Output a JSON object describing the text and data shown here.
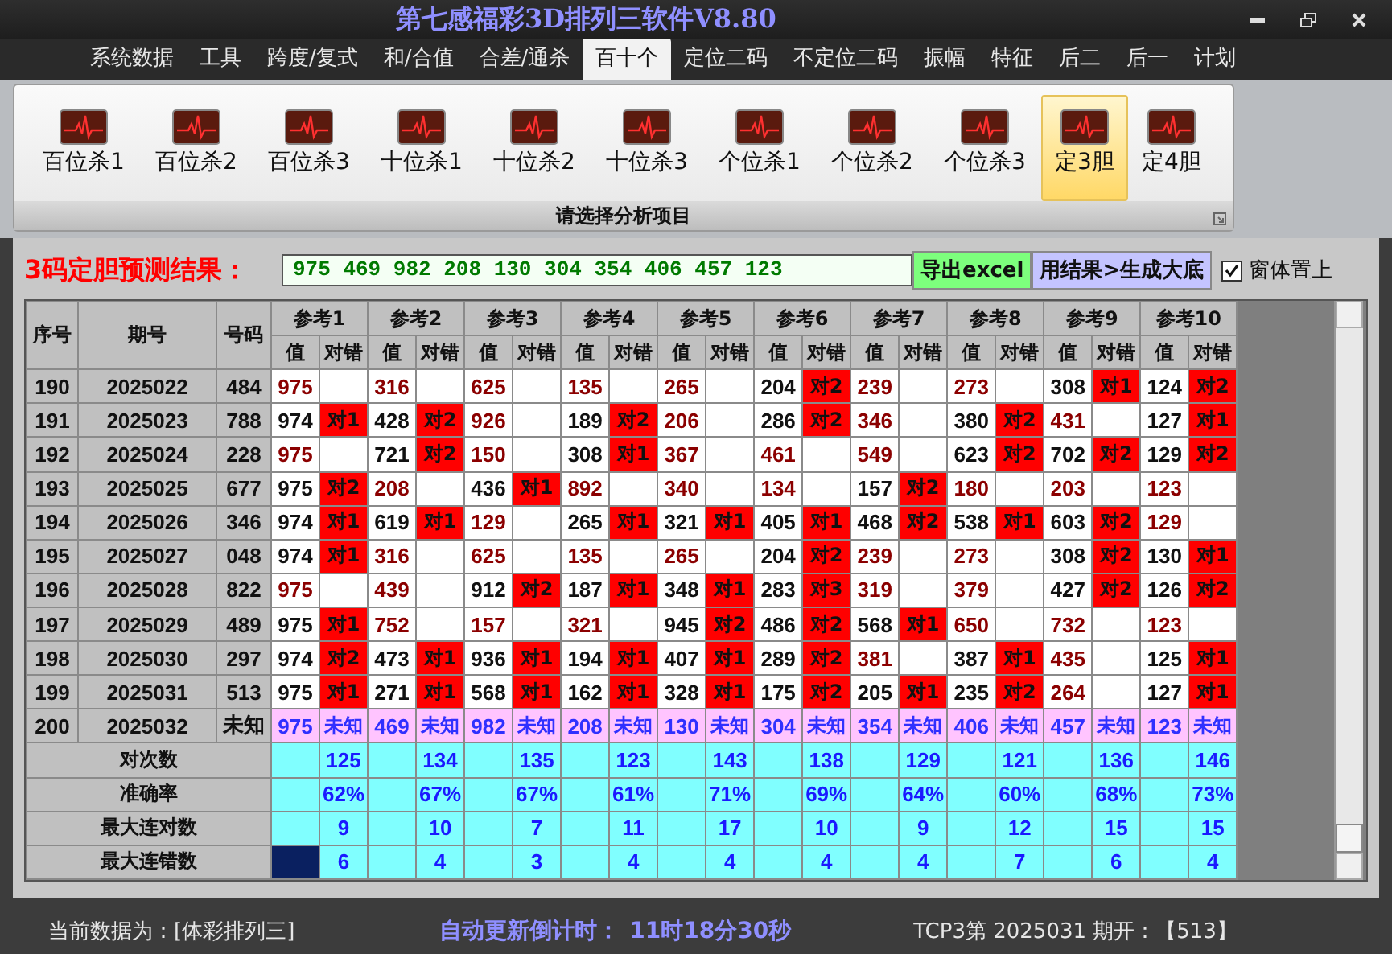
{
  "window": {
    "title": "第七感福彩3D排列三软件V8.80"
  },
  "menu": [
    {
      "label": "系统数据",
      "selected": false
    },
    {
      "label": "工具",
      "selected": false
    },
    {
      "label": "跨度/复式",
      "selected": false
    },
    {
      "label": "和/合值",
      "selected": false
    },
    {
      "label": "合差/通杀",
      "selected": false
    },
    {
      "label": "百十个",
      "selected": true
    },
    {
      "label": "定位二码",
      "selected": false
    },
    {
      "label": "不定位二码",
      "selected": false
    },
    {
      "label": "振幅",
      "selected": false
    },
    {
      "label": "特征",
      "selected": false
    },
    {
      "label": "后二",
      "selected": false
    },
    {
      "label": "后一",
      "selected": false
    },
    {
      "label": "计划",
      "selected": false
    }
  ],
  "ribbon": {
    "items": [
      {
        "label": "百位杀1",
        "selected": false
      },
      {
        "label": "百位杀2",
        "selected": false
      },
      {
        "label": "百位杀3",
        "selected": false
      },
      {
        "label": "十位杀1",
        "selected": false
      },
      {
        "label": "十位杀2",
        "selected": false
      },
      {
        "label": "十位杀3",
        "selected": false
      },
      {
        "label": "个位杀1",
        "selected": false
      },
      {
        "label": "个位杀2",
        "selected": false
      },
      {
        "label": "个位杀3",
        "selected": false
      },
      {
        "label": "定3胆",
        "selected": true
      },
      {
        "label": "定4胆",
        "selected": false
      }
    ],
    "group_label": "请选择分析项目"
  },
  "prediction": {
    "label": "3码定胆预测结果：",
    "value": "975 469 982 208 130 304 354 406 457 123",
    "export_button": "导出excel",
    "generate_button": "用结果>生成大底",
    "topmost_checkbox": {
      "label": "窗体置上",
      "checked": true
    }
  },
  "table": {
    "seq_header": "序号",
    "issue_header": "期号",
    "number_header": "号码",
    "refs": [
      {
        "label": "参考1",
        "value_header": "值",
        "result_header": "对错"
      },
      {
        "label": "参考2",
        "value_header": "值",
        "result_header": "对错"
      },
      {
        "label": "参考3",
        "value_header": "值",
        "result_header": "对错"
      },
      {
        "label": "参考4",
        "value_header": "值",
        "result_header": "对错"
      },
      {
        "label": "参考5",
        "value_header": "值",
        "result_header": "对错"
      },
      {
        "label": "参考6",
        "value_header": "值",
        "result_header": "对错"
      },
      {
        "label": "参考7",
        "value_header": "值",
        "result_header": "对错"
      },
      {
        "label": "参考8",
        "value_header": "值",
        "result_header": "对错"
      },
      {
        "label": "参考9",
        "value_header": "值",
        "result_header": "对错"
      },
      {
        "label": "参考10",
        "value_header": "值",
        "result_header": "对错"
      }
    ],
    "rows": [
      {
        "kind": "history",
        "seq": "190",
        "issue": "2025022",
        "number": "484",
        "cells": [
          {
            "value": "975"
          },
          {
            "value": "316"
          },
          {
            "value": "625"
          },
          {
            "value": "135"
          },
          {
            "value": "265"
          },
          {
            "value": "204",
            "result": "对2"
          },
          {
            "value": "239"
          },
          {
            "value": "273"
          },
          {
            "value": "308",
            "result": "对1"
          },
          {
            "value": "124",
            "result": "对2"
          }
        ]
      },
      {
        "kind": "history",
        "seq": "191",
        "issue": "2025023",
        "number": "788",
        "cells": [
          {
            "value": "974",
            "result": "对1"
          },
          {
            "value": "428",
            "result": "对2"
          },
          {
            "value": "926"
          },
          {
            "value": "189",
            "result": "对2"
          },
          {
            "value": "206"
          },
          {
            "value": "286",
            "result": "对2"
          },
          {
            "value": "346"
          },
          {
            "value": "380",
            "result": "对2"
          },
          {
            "value": "431"
          },
          {
            "value": "127",
            "result": "对1"
          }
        ]
      },
      {
        "kind": "history",
        "seq": "192",
        "issue": "2025024",
        "number": "228",
        "cells": [
          {
            "value": "975"
          },
          {
            "value": "721",
            "result": "对2"
          },
          {
            "value": "150"
          },
          {
            "value": "308",
            "result": "对1"
          },
          {
            "value": "367"
          },
          {
            "value": "461"
          },
          {
            "value": "549"
          },
          {
            "value": "623",
            "result": "对2"
          },
          {
            "value": "702",
            "result": "对2"
          },
          {
            "value": "129",
            "result": "对2"
          }
        ]
      },
      {
        "kind": "history",
        "seq": "193",
        "issue": "2025025",
        "number": "677",
        "cells": [
          {
            "value": "975",
            "result": "对2"
          },
          {
            "value": "208"
          },
          {
            "value": "436",
            "result": "对1"
          },
          {
            "value": "892"
          },
          {
            "value": "340"
          },
          {
            "value": "134"
          },
          {
            "value": "157",
            "result": "对2"
          },
          {
            "value": "180"
          },
          {
            "value": "203"
          },
          {
            "value": "123"
          }
        ]
      },
      {
        "kind": "history",
        "seq": "194",
        "issue": "2025026",
        "number": "346",
        "cells": [
          {
            "value": "974",
            "result": "对1"
          },
          {
            "value": "619",
            "result": "对1"
          },
          {
            "value": "129"
          },
          {
            "value": "265",
            "result": "对1"
          },
          {
            "value": "321",
            "result": "对1"
          },
          {
            "value": "405",
            "result": "对1"
          },
          {
            "value": "468",
            "result": "对2"
          },
          {
            "value": "538",
            "result": "对1"
          },
          {
            "value": "603",
            "result": "对2"
          },
          {
            "value": "129"
          }
        ]
      },
      {
        "kind": "history",
        "seq": "195",
        "issue": "2025027",
        "number": "048",
        "cells": [
          {
            "value": "974",
            "result": "对1"
          },
          {
            "value": "316"
          },
          {
            "value": "625"
          },
          {
            "value": "135"
          },
          {
            "value": "265"
          },
          {
            "value": "204",
            "result": "对2"
          },
          {
            "value": "239"
          },
          {
            "value": "273"
          },
          {
            "value": "308",
            "result": "对2"
          },
          {
            "value": "130",
            "result": "对1"
          }
        ]
      },
      {
        "kind": "history",
        "seq": "196",
        "issue": "2025028",
        "number": "822",
        "cells": [
          {
            "value": "975"
          },
          {
            "value": "439"
          },
          {
            "value": "912",
            "result": "对2"
          },
          {
            "value": "187",
            "result": "对1"
          },
          {
            "value": "348",
            "result": "对1"
          },
          {
            "value": "283",
            "result": "对3"
          },
          {
            "value": "319"
          },
          {
            "value": "379"
          },
          {
            "value": "427",
            "result": "对2"
          },
          {
            "value": "126",
            "result": "对2"
          }
        ]
      },
      {
        "kind": "history",
        "seq": "197",
        "issue": "2025029",
        "number": "489",
        "cells": [
          {
            "value": "975",
            "result": "对1"
          },
          {
            "value": "752"
          },
          {
            "value": "157"
          },
          {
            "value": "321"
          },
          {
            "value": "945",
            "result": "对2"
          },
          {
            "value": "486",
            "result": "对2"
          },
          {
            "value": "568",
            "result": "对1"
          },
          {
            "value": "650"
          },
          {
            "value": "732"
          },
          {
            "value": "123"
          }
        ]
      },
      {
        "kind": "history",
        "seq": "198",
        "issue": "2025030",
        "number": "297",
        "cells": [
          {
            "value": "974",
            "result": "对2"
          },
          {
            "value": "473",
            "result": "对1"
          },
          {
            "value": "936",
            "result": "对1"
          },
          {
            "value": "194",
            "result": "对1"
          },
          {
            "value": "407",
            "result": "对1"
          },
          {
            "value": "289",
            "result": "对2"
          },
          {
            "value": "381"
          },
          {
            "value": "387",
            "result": "对1"
          },
          {
            "value": "435"
          },
          {
            "value": "125",
            "result": "对1"
          }
        ]
      },
      {
        "kind": "history",
        "seq": "199",
        "issue": "2025031",
        "number": "513",
        "cells": [
          {
            "value": "975",
            "result": "对1"
          },
          {
            "value": "271",
            "result": "对1"
          },
          {
            "value": "568",
            "result": "对1"
          },
          {
            "value": "162",
            "result": "对1"
          },
          {
            "value": "328",
            "result": "对1"
          },
          {
            "value": "175",
            "result": "对2"
          },
          {
            "value": "205",
            "result": "对1"
          },
          {
            "value": "235",
            "result": "对2"
          },
          {
            "value": "264"
          },
          {
            "value": "127",
            "result": "对1"
          }
        ]
      },
      {
        "kind": "pending",
        "seq": "200",
        "issue": "2025032",
        "number": "未知",
        "cells": [
          {
            "value": "975",
            "result": "未知"
          },
          {
            "value": "469",
            "result": "未知"
          },
          {
            "value": "982",
            "result": "未知"
          },
          {
            "value": "208",
            "result": "未知"
          },
          {
            "value": "130",
            "result": "未知"
          },
          {
            "value": "304",
            "result": "未知"
          },
          {
            "value": "354",
            "result": "未知"
          },
          {
            "value": "406",
            "result": "未知"
          },
          {
            "value": "457",
            "result": "未知"
          },
          {
            "value": "123",
            "result": "未知"
          }
        ]
      }
    ],
    "stats": [
      {
        "label": "对次数",
        "selected": false,
        "values": [
          "125",
          "134",
          "135",
          "123",
          "143",
          "138",
          "129",
          "121",
          "136",
          "146"
        ]
      },
      {
        "label": "准确率",
        "selected": false,
        "values": [
          "62%",
          "67%",
          "67%",
          "61%",
          "71%",
          "69%",
          "64%",
          "60%",
          "68%",
          "73%"
        ]
      },
      {
        "label": "最大连对数",
        "selected": false,
        "values": [
          "9",
          "10",
          "7",
          "11",
          "17",
          "10",
          "9",
          "12",
          "15",
          "15"
        ]
      },
      {
        "label": "最大连错数",
        "selected": true,
        "values": [
          "6",
          "4",
          "3",
          "4",
          "4",
          "4",
          "4",
          "7",
          "6",
          "4"
        ]
      }
    ]
  },
  "status_bar": {
    "data_source": "当前数据为：[体彩排列三]",
    "countdown_label": "自动更新倒计时：",
    "countdown": "11时18分30秒",
    "last_draw": "TCP3第 2025031 期开：【513】"
  }
}
